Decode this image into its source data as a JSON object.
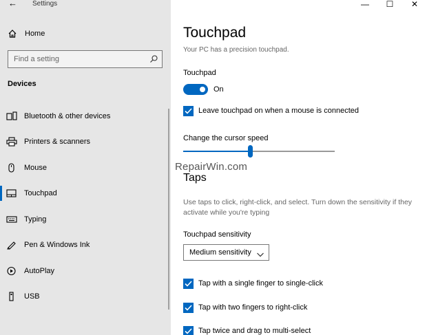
{
  "window": {
    "title": "Settings",
    "controls": [
      "—",
      "☐",
      "✕"
    ]
  },
  "sidebar": {
    "home_label": "Home",
    "search_placeholder": "Find a setting",
    "section_heading": "Devices",
    "items": [
      {
        "label": "Bluetooth & other devices",
        "icon": "bluetooth-icon"
      },
      {
        "label": "Printers & scanners",
        "icon": "printer-icon"
      },
      {
        "label": "Mouse",
        "icon": "mouse-icon"
      },
      {
        "label": "Touchpad",
        "icon": "touchpad-icon",
        "selected": true
      },
      {
        "label": "Typing",
        "icon": "keyboard-icon"
      },
      {
        "label": "Pen & Windows Ink",
        "icon": "pen-icon"
      },
      {
        "label": "AutoPlay",
        "icon": "autoplay-icon"
      },
      {
        "label": "USB",
        "icon": "usb-icon"
      }
    ]
  },
  "main": {
    "title": "Touchpad",
    "subtitle": "Your PC has a precision touchpad.",
    "touchpad_label": "Touchpad",
    "toggle_state": "On",
    "leave_on_label": "Leave touchpad on when a mouse is connected",
    "cursor_speed_label": "Change the cursor speed",
    "cursor_speed_fraction": 0.44,
    "watermark": "RepairWin.com",
    "taps_heading": "Taps",
    "taps_description": "Use taps to click, right-click, and select. Turn down the sensitivity if they activate while you're typing",
    "sensitivity_label": "Touchpad sensitivity",
    "sensitivity_value": "Medium sensitivity",
    "tap_options": [
      "Tap with a single finger to single-click",
      "Tap with two fingers to right-click",
      "Tap twice and drag to multi-select"
    ]
  },
  "colors": {
    "accent": "#0067c0",
    "sidebar_bg": "#e6e6e6"
  }
}
